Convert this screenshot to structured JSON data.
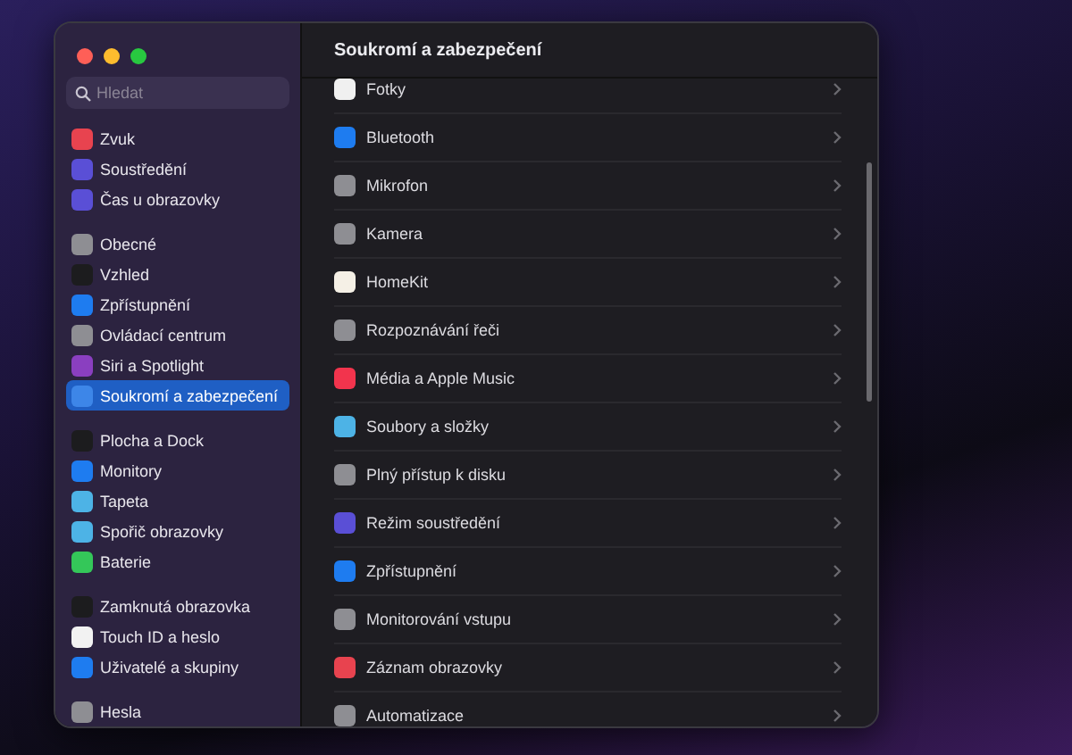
{
  "search": {
    "placeholder": "Hledat"
  },
  "sidebar": {
    "groups": [
      {
        "items": [
          {
            "label": "Zvuk",
            "color": "#e8434f",
            "selected": false
          },
          {
            "label": "Soustředění",
            "color": "#5a4fd6",
            "selected": false
          },
          {
            "label": "Čas u obrazovky",
            "color": "#5a4fd6",
            "selected": false
          }
        ]
      },
      {
        "items": [
          {
            "label": "Obecné",
            "color": "#8e8e93",
            "selected": false
          },
          {
            "label": "Vzhled",
            "color": "#1c1c1e",
            "selected": false
          },
          {
            "label": "Zpřístupnění",
            "color": "#1e7cf0",
            "selected": false
          },
          {
            "label": "Ovládací centrum",
            "color": "#8e8e93",
            "selected": false
          },
          {
            "label": "Siri a Spotlight",
            "color": "#8a3fc0",
            "selected": false
          },
          {
            "label": "Soukromí a zabezpečení",
            "color": "#3d86e8",
            "selected": true
          }
        ]
      },
      {
        "items": [
          {
            "label": "Plocha a Dock",
            "color": "#1c1c1e",
            "selected": false
          },
          {
            "label": "Monitory",
            "color": "#1e7cf0",
            "selected": false
          },
          {
            "label": "Tapeta",
            "color": "#4db3e6",
            "selected": false
          },
          {
            "label": "Spořič obrazovky",
            "color": "#4db3e6",
            "selected": false
          },
          {
            "label": "Baterie",
            "color": "#34c759",
            "selected": false
          }
        ]
      },
      {
        "items": [
          {
            "label": "Zamknutá obrazovka",
            "color": "#1c1c1e",
            "selected": false
          },
          {
            "label": "Touch ID a heslo",
            "color": "#f2f2f2",
            "selected": false
          },
          {
            "label": "Uživatelé a skupiny",
            "color": "#1e7cf0",
            "selected": false
          }
        ]
      },
      {
        "items": [
          {
            "label": "Hesla",
            "color": "#8e8e93",
            "selected": false
          }
        ]
      }
    ]
  },
  "pane": {
    "title": "Soukromí a zabezpečení",
    "rows": [
      {
        "label": "Fotky",
        "color": "#f0f0f0"
      },
      {
        "label": "Bluetooth",
        "color": "#1e7cf0"
      },
      {
        "label": "Mikrofon",
        "color": "#8e8e93"
      },
      {
        "label": "Kamera",
        "color": "#8e8e93"
      },
      {
        "label": "HomeKit",
        "color": "#f5f0e6"
      },
      {
        "label": "Rozpoznávání řeči",
        "color": "#8e8e93"
      },
      {
        "label": "Média a Apple Music",
        "color": "#f2344d"
      },
      {
        "label": "Soubory a složky",
        "color": "#4db3e6"
      },
      {
        "label": "Plný přístup k disku",
        "color": "#8e8e93"
      },
      {
        "label": "Režim soustředění",
        "color": "#5a4fd6"
      },
      {
        "label": "Zpřístupnění",
        "color": "#1e7cf0"
      },
      {
        "label": "Monitorování vstupu",
        "color": "#8e8e93"
      },
      {
        "label": "Záznam obrazovky",
        "color": "#e8434f"
      },
      {
        "label": "Automatizace",
        "color": "#8e8e93"
      }
    ]
  }
}
